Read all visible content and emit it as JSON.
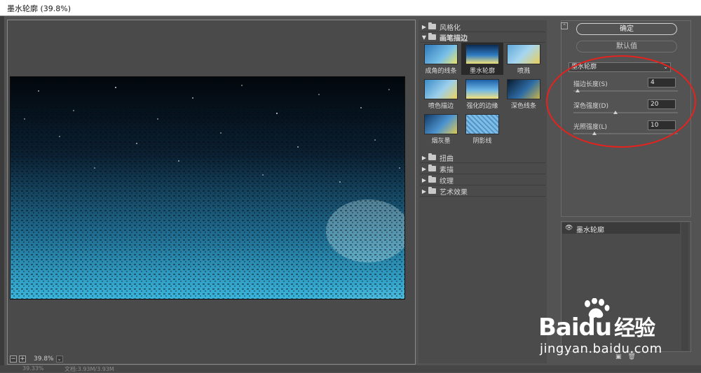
{
  "window": {
    "title": "墨水轮廓 (39.8%)"
  },
  "preview": {
    "zoom_out_label": "−",
    "zoom_in_label": "+",
    "zoom_value": "39.8%",
    "zoom_dropdown": "⌄"
  },
  "status_bar": {
    "left": "39.33%",
    "doc": "文档:3.93M/3.93M"
  },
  "filter_gallery": {
    "categories_top": [
      {
        "label": "风格化",
        "arrow": "▶"
      },
      {
        "label": "画笔描边",
        "arrow": "▼"
      }
    ],
    "thumbnails": [
      {
        "label": "成角的线条"
      },
      {
        "label": "墨水轮廓"
      },
      {
        "label": "喷溅"
      },
      {
        "label": "喷色描边"
      },
      {
        "label": "强化的边缘"
      },
      {
        "label": "深色线条"
      },
      {
        "label": "烟灰墨"
      },
      {
        "label": "阴影线"
      }
    ],
    "categories_bottom": [
      {
        "label": "扭曲",
        "arrow": "▶"
      },
      {
        "label": "素描",
        "arrow": "▶"
      },
      {
        "label": "纹理",
        "arrow": "▶"
      },
      {
        "label": "艺术效果",
        "arrow": "▶"
      }
    ]
  },
  "settings": {
    "collapse_icon": "⌃",
    "ok_label": "确定",
    "default_label": "默认值",
    "filter_select": "墨水轮廓",
    "select_chevron": "⌄",
    "params": [
      {
        "label": "描边长度(S)",
        "value": "4",
        "fraction": 0.04
      },
      {
        "label": "深色强度(D)",
        "value": "20",
        "fraction": 0.4
      },
      {
        "label": "光照强度(L)",
        "value": "10",
        "fraction": 0.2
      }
    ],
    "highlight_color": "#e5221e"
  },
  "layers": {
    "eye_icon": "👁",
    "items": [
      {
        "label": "墨水轮廓"
      }
    ],
    "new_icon": "▣",
    "trash_icon": "🗑"
  },
  "watermark": {
    "brand_a": "Bai",
    "brand_b": "du",
    "brand_cn": "经验",
    "url": "jingyan.baidu.com"
  }
}
